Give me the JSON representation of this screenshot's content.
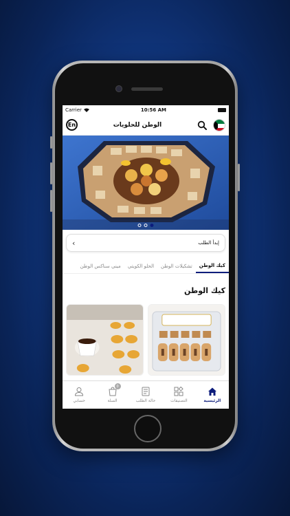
{
  "status_bar": {
    "carrier": "Carrier",
    "time": "10:56 AM"
  },
  "header": {
    "title": "الوطن للحلويات",
    "lang_button": "En"
  },
  "banner": {
    "dots": 3,
    "active_dot": 2
  },
  "order_start": {
    "label": "إبدأ الطلب"
  },
  "tabs": [
    {
      "label": "كيك الوطن",
      "active": true
    },
    {
      "label": "تشكيلات الوطن"
    },
    {
      "label": "الحلو الكويتي"
    },
    {
      "label": "ميني سناكس الوطن"
    }
  ],
  "section": {
    "title": "كيك الوطن"
  },
  "bottom_nav": [
    {
      "label": "الرئيسية",
      "icon": "home-icon",
      "active": true
    },
    {
      "label": "التصنيفات",
      "icon": "categories-icon"
    },
    {
      "label": "حالة الطلب",
      "icon": "order-status-icon"
    },
    {
      "label": "السلة",
      "icon": "cart-icon",
      "badge": "0"
    },
    {
      "label": "حسابي",
      "icon": "account-icon"
    }
  ],
  "colors": {
    "accent": "#0d1d7c",
    "background": "#123a86"
  }
}
